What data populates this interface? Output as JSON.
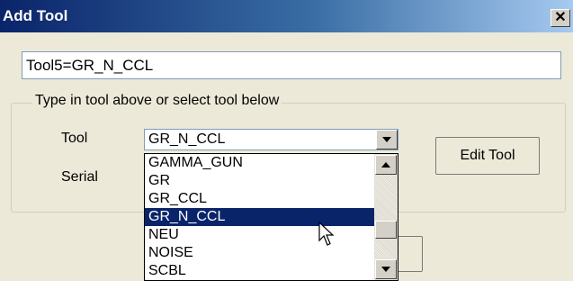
{
  "window": {
    "title": "Add Tool",
    "close_glyph": "✕"
  },
  "tool_input": {
    "value": "Tool5=GR_N_CCL"
  },
  "group": {
    "label": "Type in tool above or select tool below",
    "tool_label": "Tool",
    "serial_label": "Serial",
    "tool_combo_value": "GR_N_CCL",
    "edit_button": "Edit Tool"
  },
  "dropdown": {
    "items": [
      "GAMMA_GUN",
      "GR",
      "GR_CCL",
      "GR_N_CCL",
      "NEU",
      "NOISE",
      "SCBL"
    ],
    "selected": "GR_N_CCL"
  },
  "colors": {
    "titlebar": "#0a246a",
    "selection": "#0a246a",
    "dialog_bg": "#ece9d8"
  }
}
